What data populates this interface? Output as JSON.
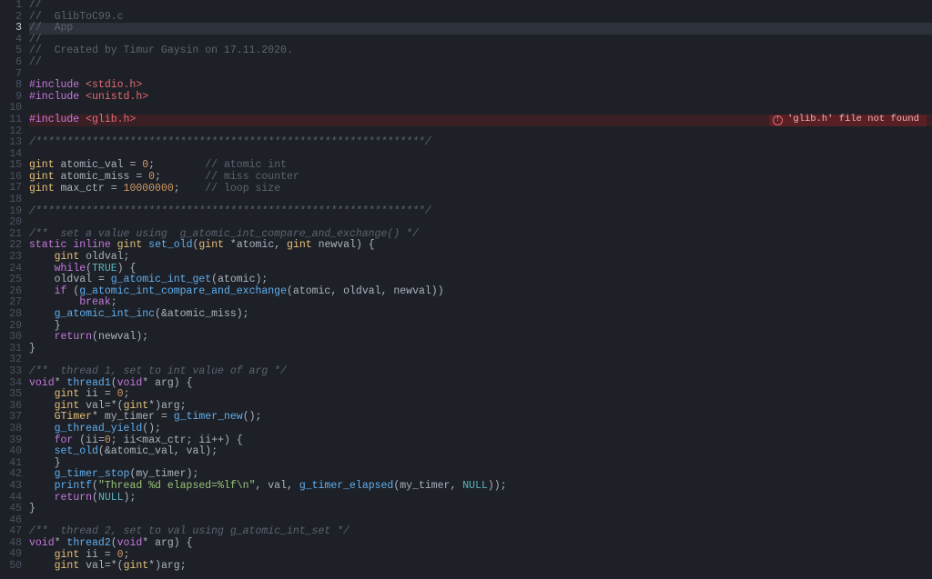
{
  "editor": {
    "active_line": 3,
    "error_line": 11,
    "error_message": "'glib.h' file not found",
    "lines": [
      {
        "n": 1,
        "t": "//"
      },
      {
        "n": 2,
        "t": "//  GlibToC99.c"
      },
      {
        "n": 3,
        "t": "//  App"
      },
      {
        "n": 4,
        "t": "//"
      },
      {
        "n": 5,
        "t": "//  Created by Timur Gaysin on 17.11.2020."
      },
      {
        "n": 6,
        "t": "//"
      },
      {
        "n": 7,
        "t": ""
      },
      {
        "n": 8,
        "t": "#include <stdio.h>"
      },
      {
        "n": 9,
        "t": "#include <unistd.h>"
      },
      {
        "n": 10,
        "t": ""
      },
      {
        "n": 11,
        "t": "#include <glib.h>"
      },
      {
        "n": 12,
        "t": ""
      },
      {
        "n": 13,
        "t": "/**************************************************************/"
      },
      {
        "n": 14,
        "t": ""
      },
      {
        "n": 15,
        "t": "gint atomic_val = 0;        // atomic int"
      },
      {
        "n": 16,
        "t": "gint atomic_miss = 0;       // miss counter"
      },
      {
        "n": 17,
        "t": "gint max_ctr = 10000000;    // loop size"
      },
      {
        "n": 18,
        "t": ""
      },
      {
        "n": 19,
        "t": "/**************************************************************/"
      },
      {
        "n": 20,
        "t": ""
      },
      {
        "n": 21,
        "t": "/**  set a value using  g_atomic_int_compare_and_exchange() */"
      },
      {
        "n": 22,
        "t": "static inline gint set_old(gint *atomic, gint newval) {"
      },
      {
        "n": 23,
        "t": "    gint oldval;"
      },
      {
        "n": 24,
        "t": "    while(TRUE) {"
      },
      {
        "n": 25,
        "t": "    oldval = g_atomic_int_get(atomic);"
      },
      {
        "n": 26,
        "t": "    if (g_atomic_int_compare_and_exchange(atomic, oldval, newval))"
      },
      {
        "n": 27,
        "t": "        break;"
      },
      {
        "n": 28,
        "t": "    g_atomic_int_inc(&atomic_miss);"
      },
      {
        "n": 29,
        "t": "    }"
      },
      {
        "n": 30,
        "t": "    return(newval);"
      },
      {
        "n": 31,
        "t": "}"
      },
      {
        "n": 32,
        "t": ""
      },
      {
        "n": 33,
        "t": "/**  thread 1, set to int value of arg */"
      },
      {
        "n": 34,
        "t": "void* thread1(void* arg) {"
      },
      {
        "n": 35,
        "t": "    gint ii = 0;"
      },
      {
        "n": 36,
        "t": "    gint val=*(gint*)arg;"
      },
      {
        "n": 37,
        "t": "    GTimer* my_timer = g_timer_new();"
      },
      {
        "n": 38,
        "t": "    g_thread_yield();"
      },
      {
        "n": 39,
        "t": "    for (ii=0; ii<max_ctr; ii++) {"
      },
      {
        "n": 40,
        "t": "    set_old(&atomic_val, val);"
      },
      {
        "n": 41,
        "t": "    }"
      },
      {
        "n": 42,
        "t": "    g_timer_stop(my_timer);"
      },
      {
        "n": 43,
        "t": "    printf(\"Thread %d elapsed=%lf\\n\", val, g_timer_elapsed(my_timer, NULL));"
      },
      {
        "n": 44,
        "t": "    return(NULL);"
      },
      {
        "n": 45,
        "t": "}"
      },
      {
        "n": 46,
        "t": ""
      },
      {
        "n": 47,
        "t": "/**  thread 2, set to val using g_atomic_int_set */"
      },
      {
        "n": 48,
        "t": "void* thread2(void* arg) {"
      },
      {
        "n": 49,
        "t": "    gint ii = 0;"
      },
      {
        "n": 50,
        "t": "    gint val=*(gint*)arg;"
      }
    ]
  }
}
